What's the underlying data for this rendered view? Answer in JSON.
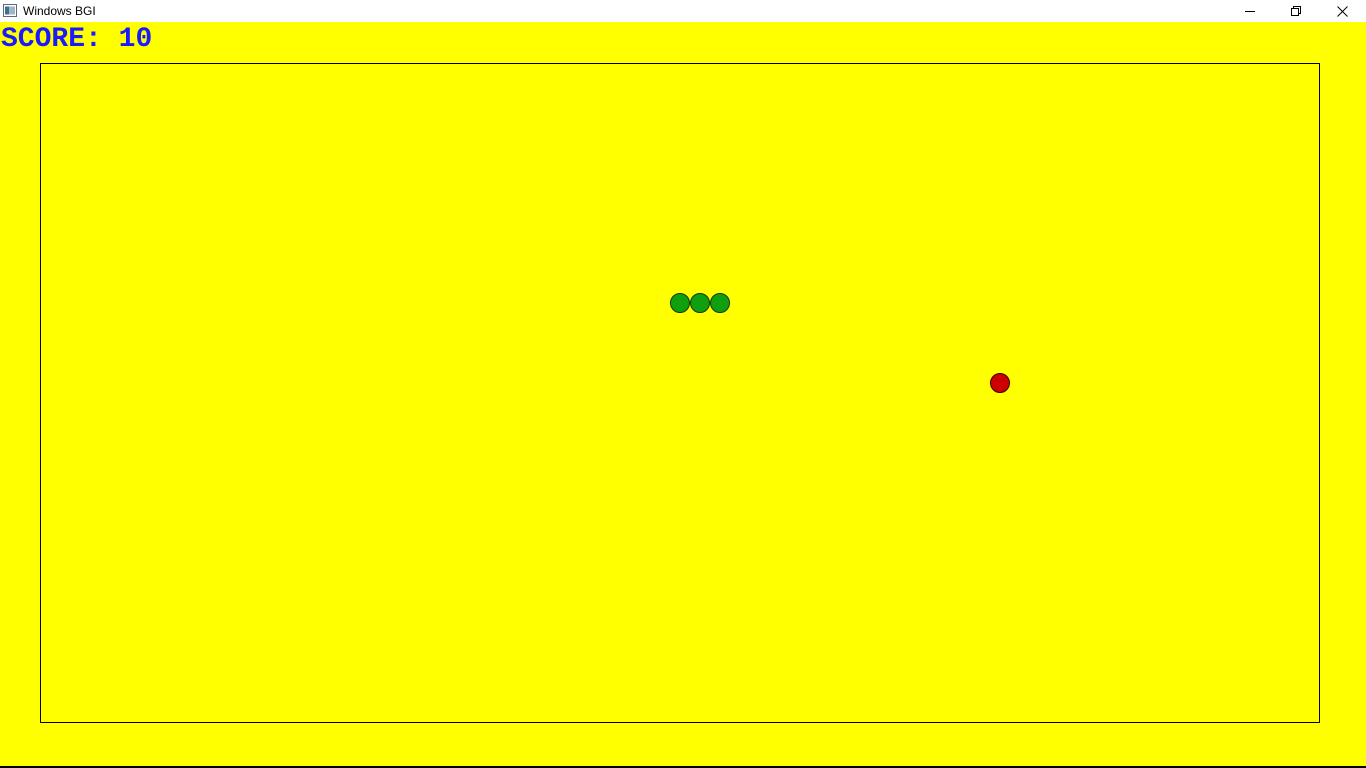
{
  "window": {
    "title": "Windows BGI",
    "icon": "bgi-window-icon",
    "controls": {
      "minimize_icon": "minimize-icon",
      "restore_icon": "restore-icon",
      "close_icon": "close-icon"
    }
  },
  "game": {
    "score_label": "SCORE:",
    "score_value": "10",
    "background_color": "#ffff00",
    "score_color": "#1a1aff",
    "snake_color": "#0f9f0f",
    "food_color": "#cc0000",
    "snake_segments": 3
  }
}
